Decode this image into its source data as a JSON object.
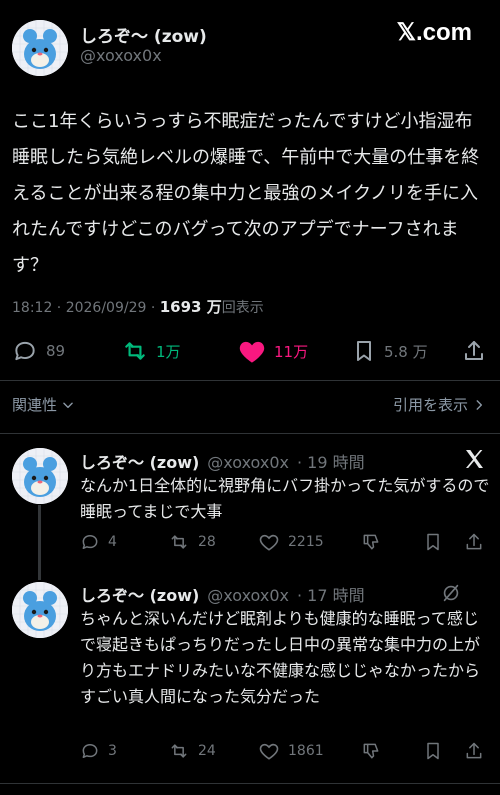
{
  "brand": "𝕏.com",
  "main": {
    "name": "しろぞ〜 (zow)",
    "handle": "@xoxox0x",
    "body": "ここ1年くらいうっすら不眠症だったんですけど小指湿布睡眠したら気絶レベルの爆睡で、午前中で大量の仕事を終えることが出来る程の集中力と最強のメイクノリを手に入れたんですけどこのバグって次のアプデでナーフされます？",
    "time": "18:12 · 2026/09/29 · ",
    "views": "1693 万",
    "views_label": "回表示",
    "replies": "89",
    "retweets": "1万",
    "likes": "11万",
    "bookmarks": "5.8 万"
  },
  "related_label": "関連性",
  "quotes_label": "引用を表示",
  "replies": [
    {
      "name": "しろぞ〜 (zow)",
      "handle": "@xoxox0x",
      "time": "· 19 時間",
      "text": "なんか1日全体的に視野角にバフ掛かってた気がするので睡眠ってまじで大事",
      "replies": "4",
      "retweets": "28",
      "likes": "2215"
    },
    {
      "name": "しろぞ〜 (zow)",
      "handle": "@xoxox0x",
      "time": "· 17 時間",
      "text": "ちゃんと深いんだけど眠剤よりも健康的な睡眠って感じで寝起きもぱっちりだったし日中の異常な集中力の上がり方もエナドリみたいな不健康な感じじゃなかったからすごい真人間になった気分だった",
      "replies": "3",
      "retweets": "24",
      "likes": "1861"
    }
  ],
  "colors": {
    "background": "#000000",
    "text": "#e7e9ea",
    "muted": "#71767b",
    "like": "#f91880",
    "retweet": "#00ba7c",
    "divider": "#2f3336"
  }
}
